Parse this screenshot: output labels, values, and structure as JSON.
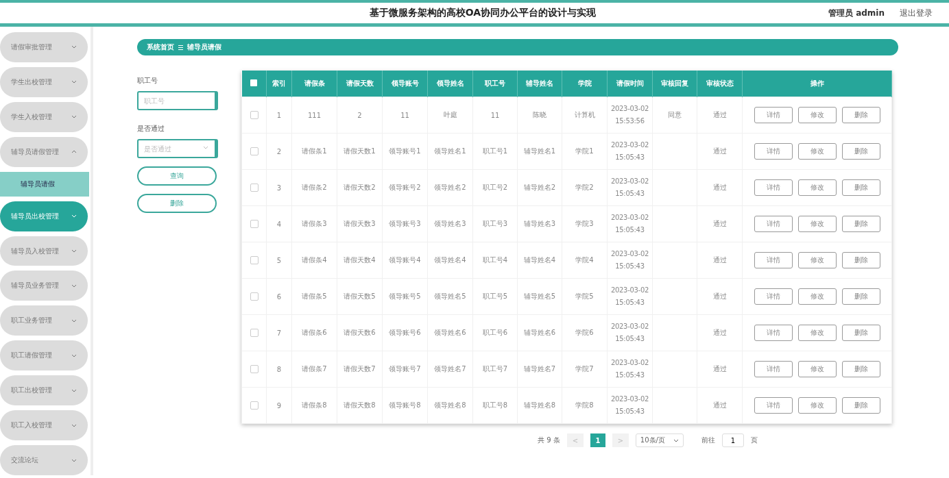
{
  "header": {
    "title": "基于微服务架构的高校OA协同办公平台的设计与实现",
    "user": "管理员 admin",
    "logout": "退出登录"
  },
  "sidebar": {
    "items": [
      {
        "label": "请假审批管理",
        "expanded": false,
        "selected": false
      },
      {
        "label": "学生出校管理",
        "expanded": false,
        "selected": false
      },
      {
        "label": "学生入校管理",
        "expanded": false,
        "selected": false
      },
      {
        "label": "辅导员请假管理",
        "expanded": true,
        "selected": false,
        "children": [
          {
            "label": "辅导员请假",
            "selected": true
          }
        ]
      },
      {
        "label": "辅导员出校管理",
        "expanded": false,
        "selected": true
      },
      {
        "label": "辅导员入校管理",
        "expanded": false,
        "selected": false
      },
      {
        "label": "辅导员业务管理",
        "expanded": false,
        "selected": false
      },
      {
        "label": "职工业务管理",
        "expanded": false,
        "selected": false
      },
      {
        "label": "职工请假管理",
        "expanded": false,
        "selected": false
      },
      {
        "label": "职工出校管理",
        "expanded": false,
        "selected": false
      },
      {
        "label": "职工入校管理",
        "expanded": false,
        "selected": false
      },
      {
        "label": "交流论坛",
        "expanded": false,
        "selected": false
      }
    ]
  },
  "breadcrumb": [
    "系统首页",
    "辅导员请假"
  ],
  "filters": [
    {
      "kind": "text",
      "label": "职工号",
      "placeholder": "职工号"
    },
    {
      "kind": "select",
      "label": "是否通过",
      "placeholder": "是否通过"
    }
  ],
  "actions": [
    "查询",
    "删除"
  ],
  "table": {
    "header_checked": false,
    "columns": [
      "索引",
      "请假条",
      "请假天数",
      "领导账号",
      "领导姓名",
      "职工号",
      "辅导姓名",
      "学院",
      "请假时间",
      "审核回复",
      "审核状态",
      "操作"
    ],
    "rows": [
      {
        "checked": false,
        "cells": [
          "1",
          "111",
          "2",
          "11",
          "叶庭",
          "11",
          "陈晓",
          "计算机",
          "2023-03-02 15:53:56",
          "同意",
          "通过"
        ],
        "actions": [
          "详情",
          "修改",
          "删除"
        ]
      },
      {
        "checked": false,
        "cells": [
          "2",
          "请假条1",
          "请假天数1",
          "领导账号1",
          "领导姓名1",
          "职工号1",
          "辅导姓名1",
          "学院1",
          "2023-03-02 15:05:43",
          "",
          "通过"
        ],
        "actions": [
          "详情",
          "修改",
          "删除"
        ]
      },
      {
        "checked": false,
        "cells": [
          "3",
          "请假条2",
          "请假天数2",
          "领导账号2",
          "领导姓名2",
          "职工号2",
          "辅导姓名2",
          "学院2",
          "2023-03-02 15:05:43",
          "",
          "通过"
        ],
        "actions": [
          "详情",
          "修改",
          "删除"
        ]
      },
      {
        "checked": false,
        "cells": [
          "4",
          "请假条3",
          "请假天数3",
          "领导账号3",
          "领导姓名3",
          "职工号3",
          "辅导姓名3",
          "学院3",
          "2023-03-02 15:05:43",
          "",
          "通过"
        ],
        "actions": [
          "详情",
          "修改",
          "删除"
        ]
      },
      {
        "checked": false,
        "cells": [
          "5",
          "请假条4",
          "请假天数4",
          "领导账号4",
          "领导姓名4",
          "职工号4",
          "辅导姓名4",
          "学院4",
          "2023-03-02 15:05:43",
          "",
          "通过"
        ],
        "actions": [
          "详情",
          "修改",
          "删除"
        ]
      },
      {
        "checked": false,
        "cells": [
          "6",
          "请假条5",
          "请假天数5",
          "领导账号5",
          "领导姓名5",
          "职工号5",
          "辅导姓名5",
          "学院5",
          "2023-03-02 15:05:43",
          "",
          "通过"
        ],
        "actions": [
          "详情",
          "修改",
          "删除"
        ]
      },
      {
        "checked": false,
        "cells": [
          "7",
          "请假条6",
          "请假天数6",
          "领导账号6",
          "领导姓名6",
          "职工号6",
          "辅导姓名6",
          "学院6",
          "2023-03-02 15:05:43",
          "",
          "通过"
        ],
        "actions": [
          "详情",
          "修改",
          "删除"
        ]
      },
      {
        "checked": false,
        "cells": [
          "8",
          "请假条7",
          "请假天数7",
          "领导账号7",
          "领导姓名7",
          "职工号7",
          "辅导姓名7",
          "学院7",
          "2023-03-02 15:05:43",
          "",
          "通过"
        ],
        "actions": [
          "详情",
          "修改",
          "删除"
        ]
      },
      {
        "checked": false,
        "cells": [
          "9",
          "请假条8",
          "请假天数8",
          "领导账号8",
          "领导姓名8",
          "职工号8",
          "辅导姓名8",
          "学院8",
          "2023-03-02 15:05:43",
          "",
          "通过"
        ],
        "actions": [
          "详情",
          "修改",
          "删除"
        ]
      }
    ]
  },
  "pagination": {
    "total": "共 9 条",
    "prev": "<",
    "pages": [
      {
        "label": "1",
        "selected": true
      }
    ],
    "next": ">",
    "page_size": "10条/页",
    "goto_label": "前往",
    "goto_value": "1",
    "goto_suffix": "页"
  }
}
